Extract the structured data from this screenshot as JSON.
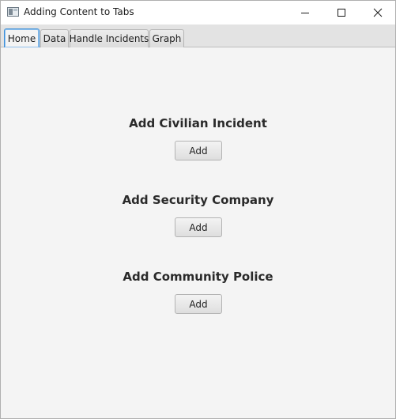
{
  "window": {
    "title": "Adding Content to Tabs",
    "controls": {
      "minimize_icon": "minimize-icon",
      "maximize_icon": "maximize-icon",
      "close_icon": "close-icon"
    }
  },
  "tabs": [
    {
      "label": "Home",
      "selected": true
    },
    {
      "label": "Data",
      "selected": false
    },
    {
      "label": "Handle Incidents",
      "selected": false
    },
    {
      "label": "Graph",
      "selected": false
    }
  ],
  "home": {
    "sections": [
      {
        "title": "Add Civilian Incident",
        "button_label": "Add"
      },
      {
        "title": "Add Security Company",
        "button_label": "Add"
      },
      {
        "title": "Add Community Police",
        "button_label": "Add"
      }
    ]
  },
  "colors": {
    "accent": "#3c8fd9",
    "background": "#f4f4f4",
    "tab_strip": "#e3e3e3"
  }
}
